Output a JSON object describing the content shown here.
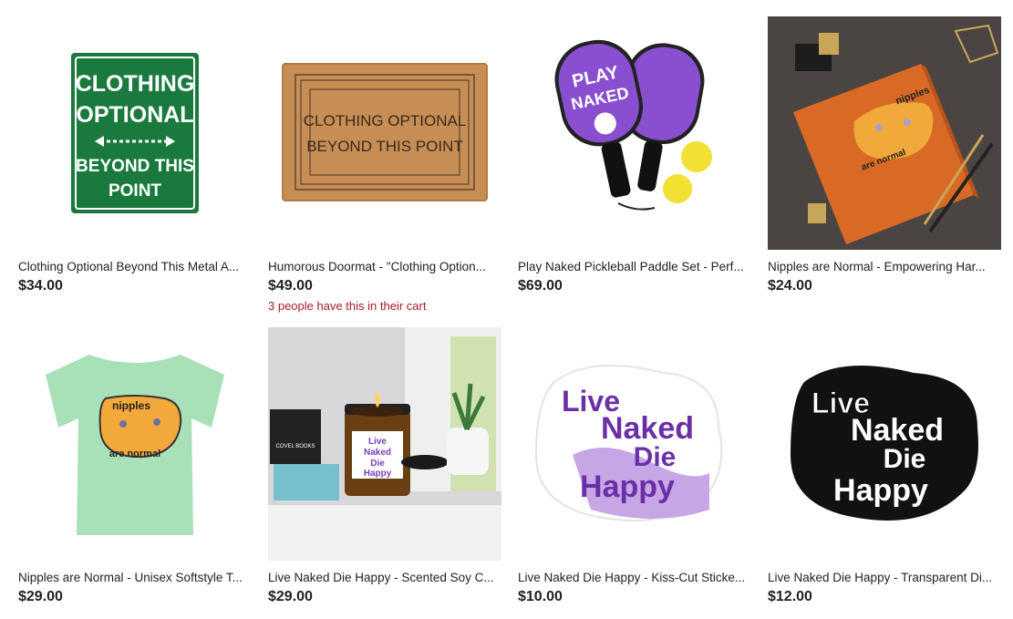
{
  "colors": {
    "cart_note": "#a61a2e",
    "text": "#222222"
  },
  "products": [
    {
      "image": "clothing-optional-metal-sign",
      "image_text": [
        "CLOTHING",
        "OPTIONAL",
        "BEYOND THIS",
        "POINT"
      ],
      "title": "Clothing Optional Beyond This Metal A...",
      "price": "$34.00"
    },
    {
      "image": "clothing-optional-doormat",
      "image_text": [
        "CLOTHING OPTIONAL",
        "BEYOND THIS POINT"
      ],
      "title": "Humorous Doormat - \"Clothing Option...",
      "price": "$49.00",
      "cart_note": "3 people have this in their cart"
    },
    {
      "image": "play-naked-pickleball-paddles",
      "image_text": [
        "PLAY",
        "NAKED"
      ],
      "title": "Play Naked Pickleball Paddle Set - Perf...",
      "price": "$69.00"
    },
    {
      "image": "nipples-are-normal-journal",
      "image_text": [
        "nipples",
        "are normal"
      ],
      "title": "Nipples are Normal - Empowering Har...",
      "price": "$24.00"
    },
    {
      "image": "nipples-are-normal-tshirt",
      "image_text": [
        "nipples",
        "are normal"
      ],
      "title": "Nipples are Normal - Unisex Softstyle T...",
      "price": "$29.00"
    },
    {
      "image": "live-naked-die-happy-candle",
      "image_text": [
        "Live",
        "Naked",
        "Die",
        "Happy",
        "COVEL BOOKS"
      ],
      "title": "Live Naked Die Happy - Scented Soy C...",
      "price": "$29.00"
    },
    {
      "image": "live-naked-die-happy-purple-sticker",
      "image_text": [
        "Live",
        "Naked",
        "Die",
        "Happy"
      ],
      "title": "Live Naked Die Happy - Kiss-Cut Sticke...",
      "price": "$10.00"
    },
    {
      "image": "live-naked-die-happy-black-sticker",
      "image_text": [
        "Live",
        "Naked",
        "Die",
        "Happy"
      ],
      "title": "Live Naked Die Happy - Transparent Di...",
      "price": "$12.00"
    }
  ]
}
